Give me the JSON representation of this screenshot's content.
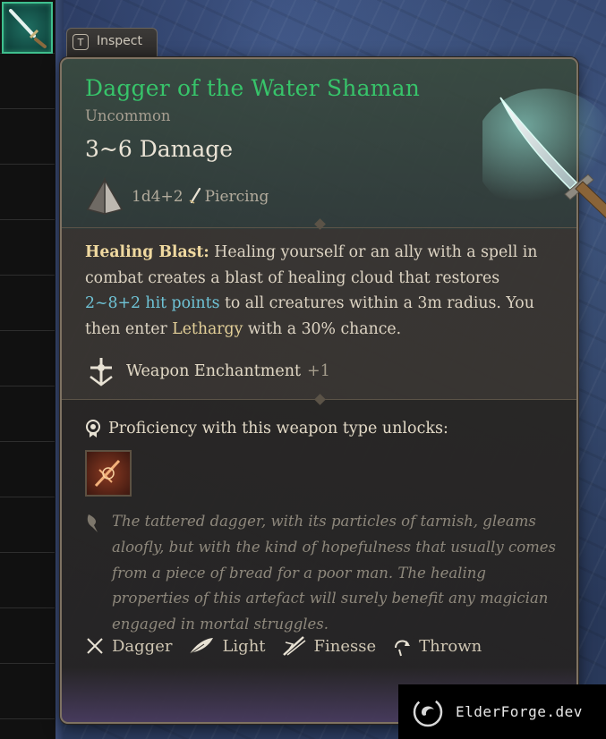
{
  "inspect_tab": {
    "key": "T",
    "label": "Inspect"
  },
  "item": {
    "name": "Dagger of the Water Shaman",
    "rarity": "Uncommon",
    "damage": "3~6 Damage",
    "dice": "1d4+2",
    "damage_type": "Piercing"
  },
  "effect": {
    "label": "Healing Blast:",
    "text_1": " Healing yourself or an ally with a spell in combat creates a blast of healing cloud that restores ",
    "highlight_heal": "2~8+2 hit points",
    "text_2": " to all creatures within a 3m radius. You then enter ",
    "highlight_condition": "Lethargy",
    "text_3": " with a 30% chance."
  },
  "enchantment": {
    "label": "Weapon Enchantment",
    "bonus": "+1"
  },
  "proficiency": {
    "label": "Proficiency with this weapon type unlocks:"
  },
  "lore": "The tattered dagger, with its particles of tarnish, gleams aloofly, but with the kind of hopefulness that usually comes from a piece of bread for a poor man. The healing properties of this artefact will surely benefit any magician engaged in mortal struggles.",
  "properties": [
    {
      "label": "Dagger",
      "icon": "crossed-daggers-icon"
    },
    {
      "label": "Light",
      "icon": "feather-icon"
    },
    {
      "label": "Finesse",
      "icon": "finesse-icon"
    },
    {
      "label": "Thrown",
      "icon": "thrown-icon"
    }
  ],
  "watermark": {
    "text": "ElderForge.dev"
  },
  "colors": {
    "title": "#37c46a",
    "rarity": "#a79f91",
    "highlight_blue": "#6fc3d6",
    "highlight_gold": "#e3cf98",
    "slot_border": "#3fbf8e"
  }
}
